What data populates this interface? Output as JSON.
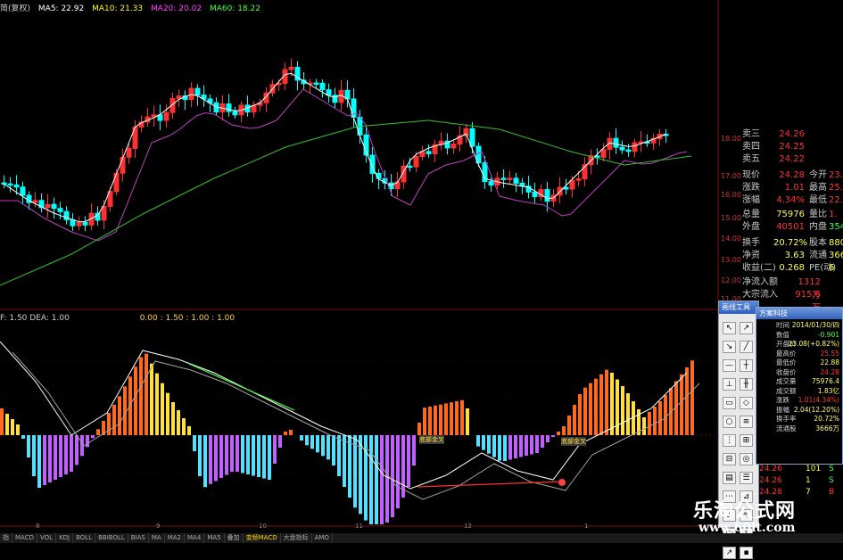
{
  "main_legend": {
    "prefix": "简(复权)",
    "ma5": "MA5: 22.92",
    "ma10": "MA10: 21.33",
    "ma20": "MA20: 20.02",
    "ma60": "MA60: 18.22"
  },
  "macd_legend": {
    "prefix": "F: 1.50  DEA: 1.00",
    "values": "0.00 : 1.50 : 1.00 : 1.00"
  },
  "macd_annotations": {
    "cross1": "底部金叉",
    "cross2": "底部金叉"
  },
  "price_axis": [
    "18.00",
    "17.00",
    "16.00",
    "15.00",
    "14.00",
    "13.00",
    "12.00",
    "11.00"
  ],
  "quote": {
    "ask3": {
      "label": "卖三",
      "value": "24.26"
    },
    "ask4": {
      "label": "卖四",
      "value": "24.25"
    },
    "ask5": {
      "label": "卖五",
      "value": "24.22"
    },
    "price": {
      "label": "现价",
      "value": "24.28",
      "label2": "今开",
      "value2": "23."
    },
    "change": {
      "label": "涨跌",
      "value": "1.01",
      "label2": "最高",
      "value2": "25."
    },
    "pct": {
      "label": "涨幅",
      "value": "4.34%",
      "label2": "最低",
      "value2": "22."
    },
    "volume": {
      "label": "总量",
      "value": "75976",
      "label2": "量比",
      "value2": "1."
    },
    "outer": {
      "label": "外盘",
      "value": "40501",
      "label2": "内盘",
      "value2": "354"
    },
    "turnover": {
      "label": "换手",
      "value": "20.72%",
      "label2": "股本",
      "value2": "880"
    },
    "netasset": {
      "label": "净资",
      "value": "3.63",
      "label2": "流通",
      "value2": "366"
    },
    "earnings": {
      "label": "收益(二)",
      "value": "0.268",
      "label2": "PE(动)",
      "value2": "6"
    },
    "netflow": {
      "label": "净流入额",
      "value": "1312万"
    },
    "bigflow": {
      "label": "大宗流入",
      "value": "915.6万"
    }
  },
  "trades": [
    {
      "price": "24.26",
      "vol": "101",
      "side": "S"
    },
    {
      "price": "24.26",
      "vol": "1",
      "side": "S"
    },
    {
      "price": "24.28",
      "vol": "7",
      "side": "B"
    }
  ],
  "tool_window": {
    "title": "画线工具",
    "tools": [
      "↖",
      "↗",
      "↘",
      "╱",
      "—",
      "┼",
      "⊥",
      "╫",
      "▭",
      "◇",
      "○",
      "≡",
      "⋮",
      "⊞",
      "⊟",
      "◎",
      "▤",
      "☰",
      "⋯",
      "⊿",
      "⌂",
      "⊕",
      "□",
      "↑",
      "↗",
      "▪"
    ]
  },
  "info_window": {
    "title": "方案科技",
    "rows": [
      {
        "label": "时间",
        "value": "2014/01/30/四"
      },
      {
        "label": "数值",
        "value": "-0.901"
      },
      {
        "label": "开盘价",
        "value": "23.08(+0.82%)"
      },
      {
        "label": "最高价",
        "value": "25.55"
      },
      {
        "label": "最低价",
        "value": "22.88"
      },
      {
        "label": "收盘价",
        "value": "24.28"
      },
      {
        "label": "成交量",
        "value": "75976.4"
      },
      {
        "label": "成交额",
        "value": "1.83亿"
      },
      {
        "label": "涨跌",
        "value": "1.01(4.34%)"
      },
      {
        "label": "振幅",
        "value": "2.04(12.20%)"
      },
      {
        "label": "换手率",
        "value": "20.72%"
      },
      {
        "label": "流通股",
        "value": "3666万"
      }
    ]
  },
  "tabs": [
    "指",
    "MACD",
    "VOL",
    "KDJ",
    "BOLL",
    "BBIBOLL",
    "BIAS",
    "MA",
    "MA2",
    "MA4",
    "MA5",
    "叠加",
    "变频MACD",
    "大盘指标",
    "AMO"
  ],
  "active_tab": "变频MACD",
  "date_labels": [
    "8",
    "9",
    "10",
    "11",
    "12",
    "1"
  ],
  "watermark": {
    "title": "乐淘公式网",
    "url": "www.60lt.com"
  },
  "colors": {
    "up": "#ff3030",
    "down": "#00ffff",
    "ma5": "#ffffff",
    "ma10": "#ffff00",
    "ma20": "#ff00ff",
    "ma60": "#00ff00",
    "hist_neg": "#55e0ff",
    "hist_neg2": "#c060ff",
    "hist_pos": "#ff6a20",
    "hist_pos2": "#ffe040"
  }
}
